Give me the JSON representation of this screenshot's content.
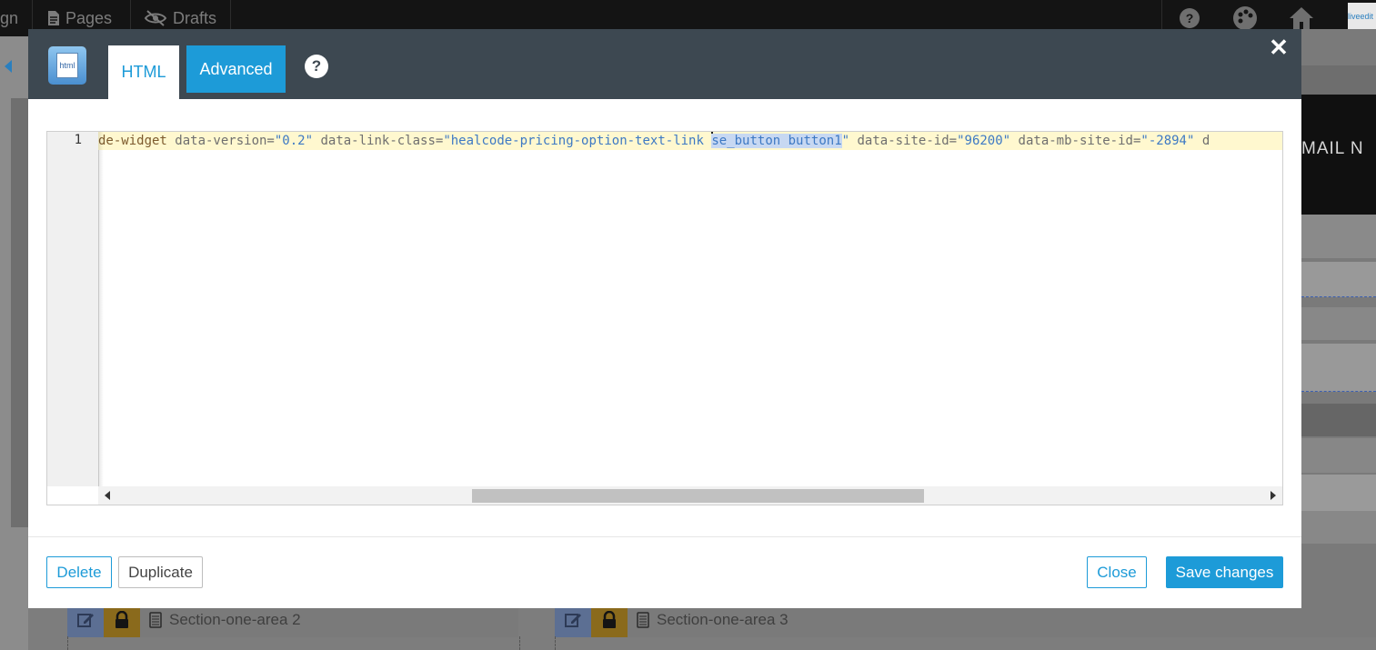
{
  "background": {
    "topbar": {
      "nav_partial": "gn",
      "pages_label": "Pages",
      "drafts_label": "Drafts"
    },
    "right_partial_text": "MAIL   N",
    "logo_text": "liveedit",
    "areas": [
      {
        "label": "Section-one-area 2"
      },
      {
        "label": "Section-one-area 3"
      }
    ]
  },
  "modal": {
    "tabs": {
      "html_label": "HTML",
      "advanced_label": "Advanced"
    },
    "help_label": "?",
    "close_glyph": "✕",
    "logo_text": "html",
    "editor": {
      "line_number": "1",
      "tokens": {
        "t1": "de-widget",
        "t2": " data-version=",
        "t3": "\"0.2\"",
        "t4": " data-link-class=",
        "t5": "\"healcode-pricing-option-text-link ",
        "t6": "se_button button1",
        "t7": "\"",
        "t8": " data-site-id=",
        "t9": "\"96200\"",
        "t10": " data-mb-site-id=",
        "t11": "\"-2894\"",
        "t12": " d"
      }
    },
    "footer": {
      "delete_label": "Delete",
      "duplicate_label": "Duplicate",
      "close_label": "Close",
      "save_label": "Save changes"
    }
  },
  "colors": {
    "accent": "#1d9bd8",
    "header": "#3d4851",
    "active_line": "#fff8cf",
    "selection": "#c7d8f2"
  }
}
